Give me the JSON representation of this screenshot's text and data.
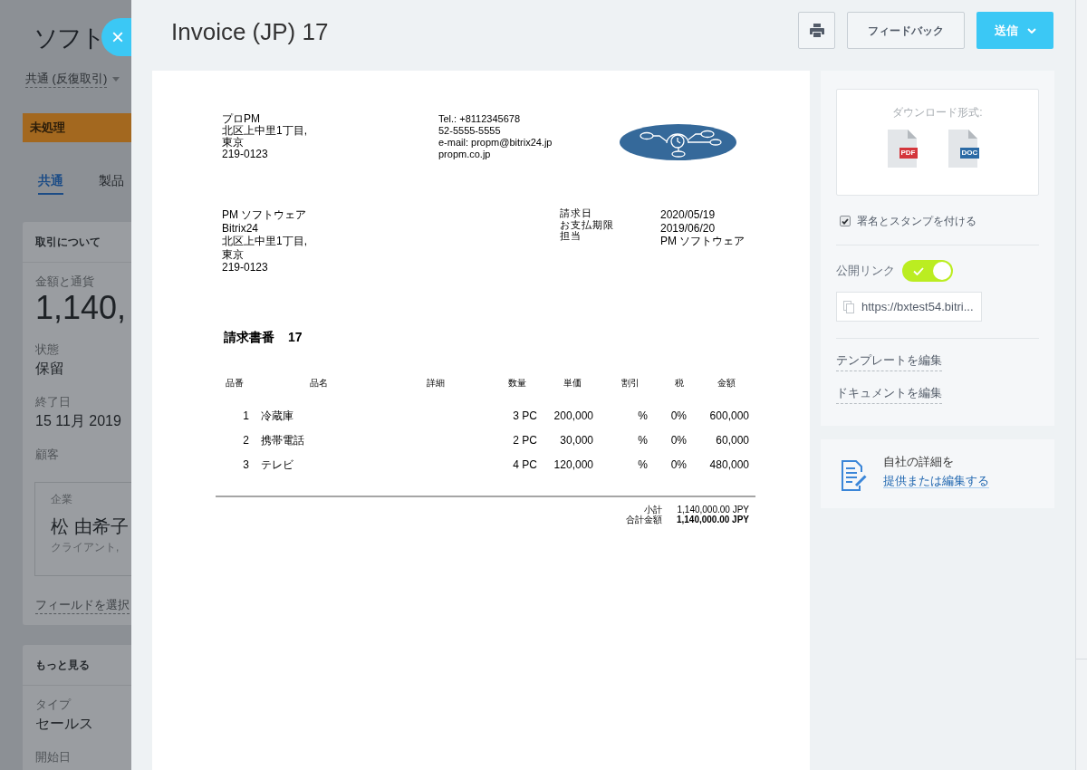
{
  "background_page": {
    "title": "ソフト",
    "close_button": "×",
    "pipeline": "共通 (反復取引)",
    "stage": "未処理",
    "tabs": [
      {
        "label": "共通",
        "selected": true
      },
      {
        "label": "製品",
        "selected": false
      }
    ],
    "about_section": {
      "title": "取引について",
      "fields": [
        {
          "label": "金額と通貨",
          "value": "1,140,",
          "kind": "amount"
        },
        {
          "label": "状態",
          "value": "保留",
          "kind": "text"
        },
        {
          "label": "終了日",
          "value": "15 11月 2019",
          "kind": "text"
        }
      ],
      "client": {
        "label": "顧客",
        "type": "企業",
        "name": "松 由希子",
        "role": "クライアント,"
      },
      "select_fields_link": "フィールドを選択"
    },
    "more_section": {
      "title": "もっと見る",
      "fields": [
        {
          "label": "タイプ",
          "value": "セールス",
          "kind": "text"
        },
        {
          "label": "開始日"
        }
      ]
    }
  },
  "header": {
    "title": "Invoice (JP) 17",
    "buttons": [
      {
        "kind": "print"
      },
      {
        "kind": "secondary",
        "label": "フィードバック"
      },
      {
        "kind": "primary",
        "label": "送信"
      }
    ]
  },
  "document": {
    "seller": [
      "プロPM",
      "北区上中里1丁目,",
      "東京",
      "219-0123"
    ],
    "contacts": [
      "Tel.: +8112345678",
      "52-5555-5555",
      "e-mail: propm@bitrix24.jp",
      "propm.co.jp"
    ],
    "buyer": [
      "PM ソフトウェア",
      "Bitrix24",
      "北区上中里1丁目,",
      "東京",
      "219-0123"
    ],
    "meta": [
      {
        "label": "請求日",
        "value": "2020/05/19"
      },
      {
        "label": "お支払期限",
        "value": "2019/06/20"
      },
      {
        "label": "担当",
        "value": "PM ソフトウェア"
      }
    ],
    "title": "請求書番",
    "number": "17",
    "columns": [
      "品番",
      "品名",
      "詳細",
      "数量",
      "単価",
      "割引",
      "税",
      "金額"
    ],
    "rows": [
      {
        "no": "1",
        "name": "冷蔵庫",
        "quantity": "3 PC",
        "price": "200,000",
        "discount": "%",
        "tax": "0%",
        "amount": "600,000"
      },
      {
        "no": "2",
        "name": "携帯電話",
        "quantity": "2 PC",
        "price": "30,000",
        "discount": "%",
        "tax": "0%",
        "amount": "60,000"
      },
      {
        "no": "3",
        "name": "テレビ",
        "quantity": "4 PC",
        "price": "120,000",
        "discount": "%",
        "tax": "0%",
        "amount": "480,000"
      }
    ],
    "totals": [
      {
        "label": "小計",
        "value": "1,140,000.00 JPY",
        "kind": "subtotal"
      },
      {
        "label": "合計金額",
        "value": "1,140,000.00 JPY",
        "kind": "total"
      }
    ]
  },
  "sidebar": {
    "download": {
      "title": "ダウンロード形式:",
      "formats": [
        {
          "label": "PDF",
          "color": "#d4363c"
        },
        {
          "label": "DOC",
          "color": "#2b6aa5"
        }
      ]
    },
    "signature": {
      "label": "署名とスタンプを付ける",
      "checked": true
    },
    "public_link": {
      "label": "公開リンク",
      "on": true,
      "url": "https://bxtest54.bitri..."
    },
    "links": [
      "テンプレートを編集",
      "ドキュメントを編集"
    ]
  },
  "company_card": {
    "text": "自社の詳細を",
    "link": "提供または編集する"
  }
}
